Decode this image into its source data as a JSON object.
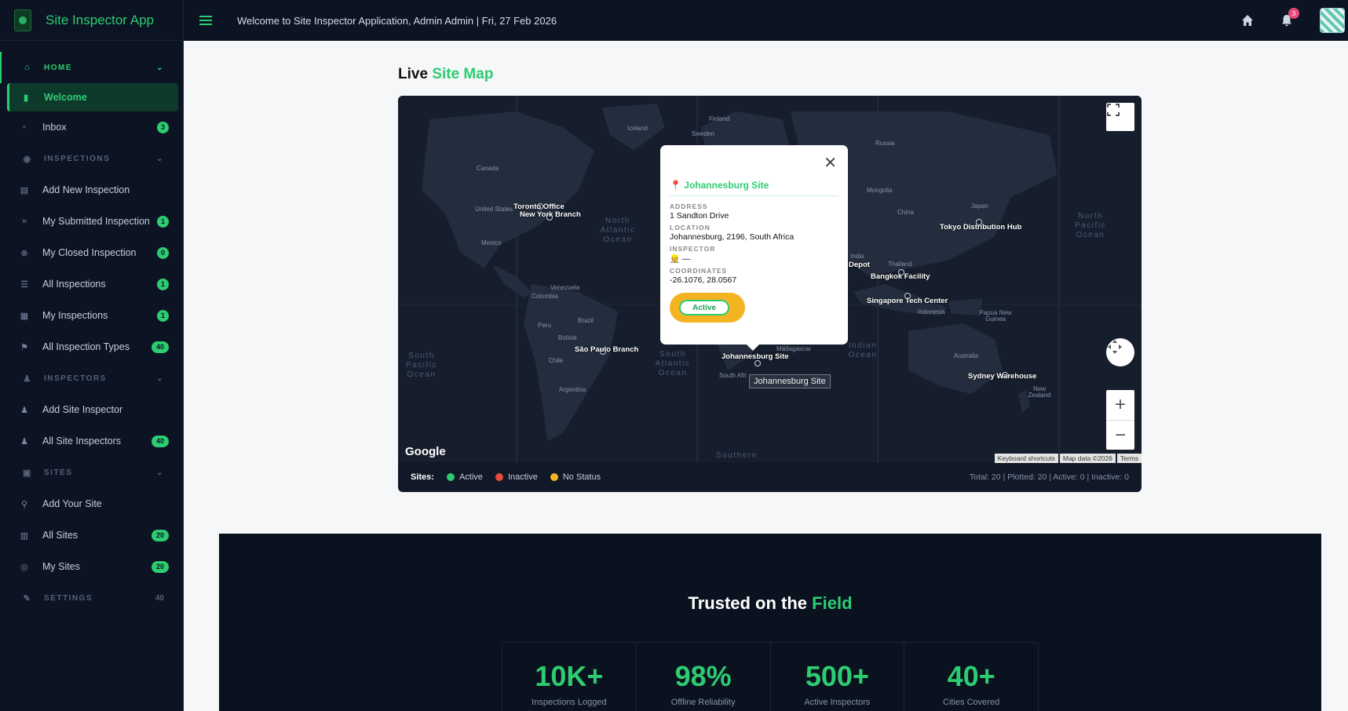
{
  "app": {
    "title": "Site Inspector App"
  },
  "header": {
    "welcome": "Welcome to Site Inspector Application, Admin Admin | Fri, 27 Feb 2026",
    "notification_count": "3"
  },
  "sidebar": {
    "home": {
      "label": "HOME"
    },
    "home_items": [
      {
        "label": "Welcome"
      },
      {
        "label": "Inbox",
        "badge": "3"
      }
    ],
    "inspections": {
      "label": "INSPECTIONS"
    },
    "inspection_items": [
      {
        "label": "Add New Inspection"
      },
      {
        "label": "My Submitted Inspection",
        "badge": "1"
      },
      {
        "label": "My Closed Inspection",
        "badge": "0"
      },
      {
        "label": "All Inspections",
        "badge": "1"
      },
      {
        "label": "My Inspections",
        "badge": "1"
      },
      {
        "label": "All Inspection Types",
        "badge": "40"
      }
    ],
    "inspectors": {
      "label": "INSPECTORS"
    },
    "inspector_items": [
      {
        "label": "Add Site Inspector"
      },
      {
        "label": "All Site Inspectors",
        "badge": "40"
      }
    ],
    "sites": {
      "label": "SITES"
    },
    "site_items": [
      {
        "label": "Add Your Site"
      },
      {
        "label": "All Sites",
        "badge": "20"
      },
      {
        "label": "My Sites",
        "badge": "20"
      }
    ],
    "settings": {
      "label": "SETTINGS",
      "count": "40"
    }
  },
  "map_section": {
    "title_prefix": "Live",
    "title_accent": "Site Map"
  },
  "map": {
    "countries": [
      "Iceland",
      "Sweden",
      "Finland",
      "Russia",
      "Canada",
      "United States",
      "Mexico",
      "Mongolia",
      "China",
      "Japan",
      "India",
      "Thailand",
      "Venezuela",
      "Colombia",
      "Brazil",
      "Peru",
      "Bolivia",
      "Chile",
      "Argentina",
      "Madagascar",
      "Indonesia",
      "Papua New Guinea",
      "Australia",
      "New Zealand",
      "South Afri"
    ],
    "oceans": [
      "North Atlantic Ocean",
      "North Pacific Ocean",
      "South Pacific Ocean",
      "South Atlantic Ocean",
      "Indian Ocean",
      "Southern"
    ],
    "pins": [
      "Toronto Office",
      "New York Branch",
      "São Paulo Branch",
      "Johannesburg Site",
      "Tokyo Distribution Hub",
      "Bangkok Facility",
      "Depot",
      "Singapore Tech Center",
      "Sydney Warehouse"
    ],
    "tooltip": "Johannesburg Site",
    "google": "Google",
    "attribution": [
      "Keyboard shortcuts",
      "Map data ©2026",
      "Terms"
    ],
    "zoom_in": "+",
    "zoom_out": "−"
  },
  "popup": {
    "title": "Johannesburg Site",
    "address_label": "ADDRESS",
    "address": "1 Sandton Drive",
    "location_label": "LOCATION",
    "location": "Johannesburg, 2196, South Africa",
    "inspector_label": "INSPECTOR",
    "inspector": "👷 —",
    "coordinates_label": "COORDINATES",
    "coordinates": "-26.1076, 28.0567",
    "status": "Active"
  },
  "legend": {
    "label": "Sites:",
    "items": [
      {
        "label": "Active",
        "color": "#2ecc71"
      },
      {
        "label": "Inactive",
        "color": "#e74c3c"
      },
      {
        "label": "No Status",
        "color": "#f4b422"
      }
    ],
    "stats": "Total: 20 | Plotted: 20 | Active: 0 | Inactive: 0"
  },
  "trusted": {
    "title_prefix": "Trusted on the",
    "title_accent": "Field",
    "stats": [
      {
        "value": "10K+",
        "label": "Inspections Logged"
      },
      {
        "value": "98%",
        "label": "Offline Reliability"
      },
      {
        "value": "500+",
        "label": "Active Inspectors"
      },
      {
        "value": "40+",
        "label": "Cities Covered"
      }
    ]
  }
}
